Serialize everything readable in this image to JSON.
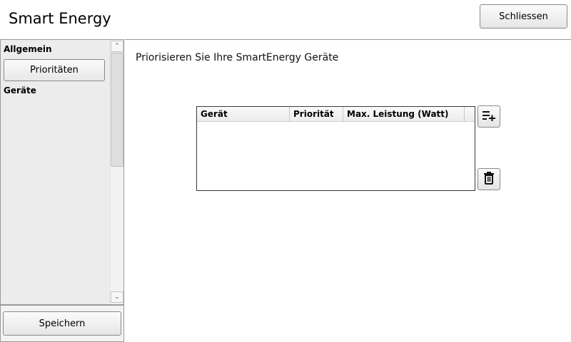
{
  "app": {
    "title": "Smart Energy",
    "close_label": "Schliessen"
  },
  "sidebar": {
    "sections": [
      {
        "label": "Allgemein",
        "items": [
          {
            "label": "Prioritäten",
            "selected": false
          }
        ]
      },
      {
        "label": "Geräte",
        "items": []
      }
    ],
    "save_label": "Speichern"
  },
  "main": {
    "subtitle": "Priorisieren Sie Ihre SmartEnergy Geräte",
    "table": {
      "columns": [
        "Gerät",
        "Priorität",
        "Max. Leistung (Watt)"
      ],
      "rows": []
    },
    "actions": {
      "add_icon": "add-list-icon",
      "delete_icon": "trash-icon"
    }
  }
}
